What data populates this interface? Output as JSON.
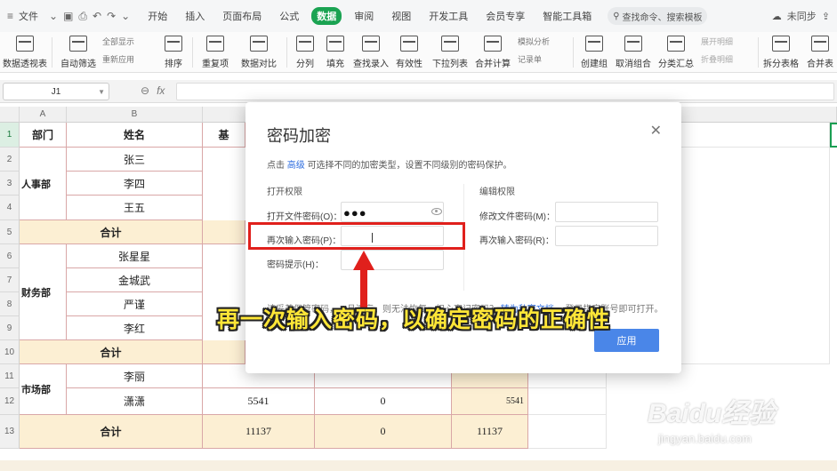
{
  "menubar": {
    "file": "文件",
    "tabs": [
      "开始",
      "插入",
      "页面布局",
      "公式",
      "数据",
      "审阅",
      "视图",
      "开发工具",
      "会员专享",
      "智能工具箱"
    ],
    "active_tab": "数据",
    "search": "查找命令、搜索模板",
    "user": "未同步"
  },
  "ribbon": {
    "pivot": "数据透视表",
    "autofilter": "自动筛选",
    "show_all": "全部显示",
    "reapply": "重新应用",
    "sort": "排序",
    "dup": "重复项",
    "compare": "数据对比",
    "split": "分列",
    "fill": "填充",
    "lookup": "查找录入",
    "validity": "有效性",
    "dropdown": "下拉列表",
    "consolidate": "合并计算",
    "simulate": "模拟分析",
    "record": "记录单",
    "group": "创建组",
    "ungroup": "取消组合",
    "subtotal": "分类汇总",
    "expand": "展开明细",
    "collapse": "折叠明细",
    "split_table": "拆分表格",
    "merge_table": "合并表"
  },
  "formula_bar": {
    "cell_ref": "J1",
    "fx": "fx"
  },
  "columns": [
    "A",
    "B"
  ],
  "rows": [
    "1",
    "2",
    "3",
    "4",
    "5",
    "6",
    "7",
    "8",
    "9",
    "10",
    "11",
    "12",
    "13"
  ],
  "table": {
    "h_dept": "部门",
    "h_name": "姓名",
    "h_c_partial": "基",
    "names": [
      "张三",
      "李四",
      "王五",
      "张星星",
      "金城武",
      "严谨",
      "李红",
      "李丽",
      "潇潇"
    ],
    "depts": [
      "人事部",
      "财务部",
      "市场部"
    ],
    "sum_label": "合计",
    "row12": [
      "5541",
      "0",
      "5541"
    ],
    "row13": [
      "11137",
      "0",
      "11137"
    ]
  },
  "dialog": {
    "title": "密码加密",
    "desc_prefix": "点击",
    "desc_link": "高级",
    "desc_suffix": "可选择不同的加密类型，设置不同级别的密码保护。",
    "open_section": "打开权限",
    "edit_section": "编辑权限",
    "open_pwd_label": "打开文件密码(O)：",
    "open_pwd_value": "●●●",
    "reenter_label": "再次输入密码(P)：",
    "hint_label": "密码提示(H)：",
    "edit_pwd_label": "修改文件密码(M)：",
    "edit_reenter_label": "再次输入密码(R)：",
    "note_prefix": "请妥善保管密码，一旦遗忘，则无法恢复。担心忘记密码？",
    "note_link": "转为私密文档",
    "note_suffix": "，登录指定账号即可打开。",
    "ok": "应用"
  },
  "annotation": {
    "caption": "再一次输入密码，以确定密码的正确性"
  },
  "watermark": {
    "brand": "Baidu经验",
    "url": "jingyan.baidu.com"
  }
}
